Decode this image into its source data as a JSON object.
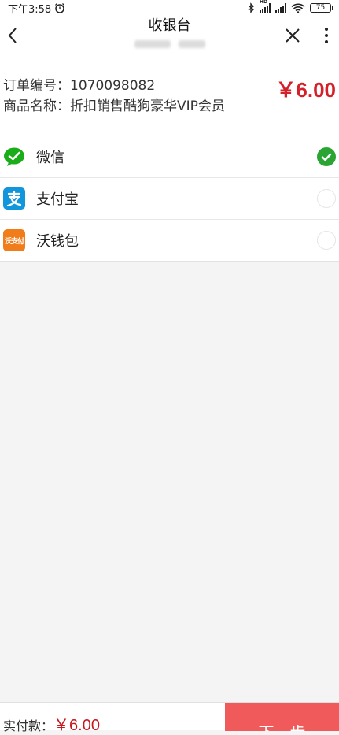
{
  "status_bar": {
    "time": "下午3:58",
    "battery": "75",
    "hd_label": "HD"
  },
  "nav": {
    "title": "收银台"
  },
  "order": {
    "number_label": "订单编号：",
    "number": "1070098082",
    "product_label": "商品名称：",
    "product": "折扣销售酷狗豪华VIP会员",
    "price": "￥6.00"
  },
  "payment_methods": [
    {
      "label": "微信",
      "icon": "wechat-icon",
      "color": "#1aad19",
      "selected": true
    },
    {
      "label": "支付宝",
      "icon": "alipay-icon",
      "color": "#1296db",
      "selected": false
    },
    {
      "label": "沃钱包",
      "icon": "wo-wallet-icon",
      "color": "#f07d1a",
      "selected": false,
      "icon_text": "沃支付"
    }
  ],
  "footer": {
    "total_label": "实付款：",
    "total_amount": "￥6.00",
    "next_label": "下一步",
    "accent_color": "#f05a5a"
  }
}
